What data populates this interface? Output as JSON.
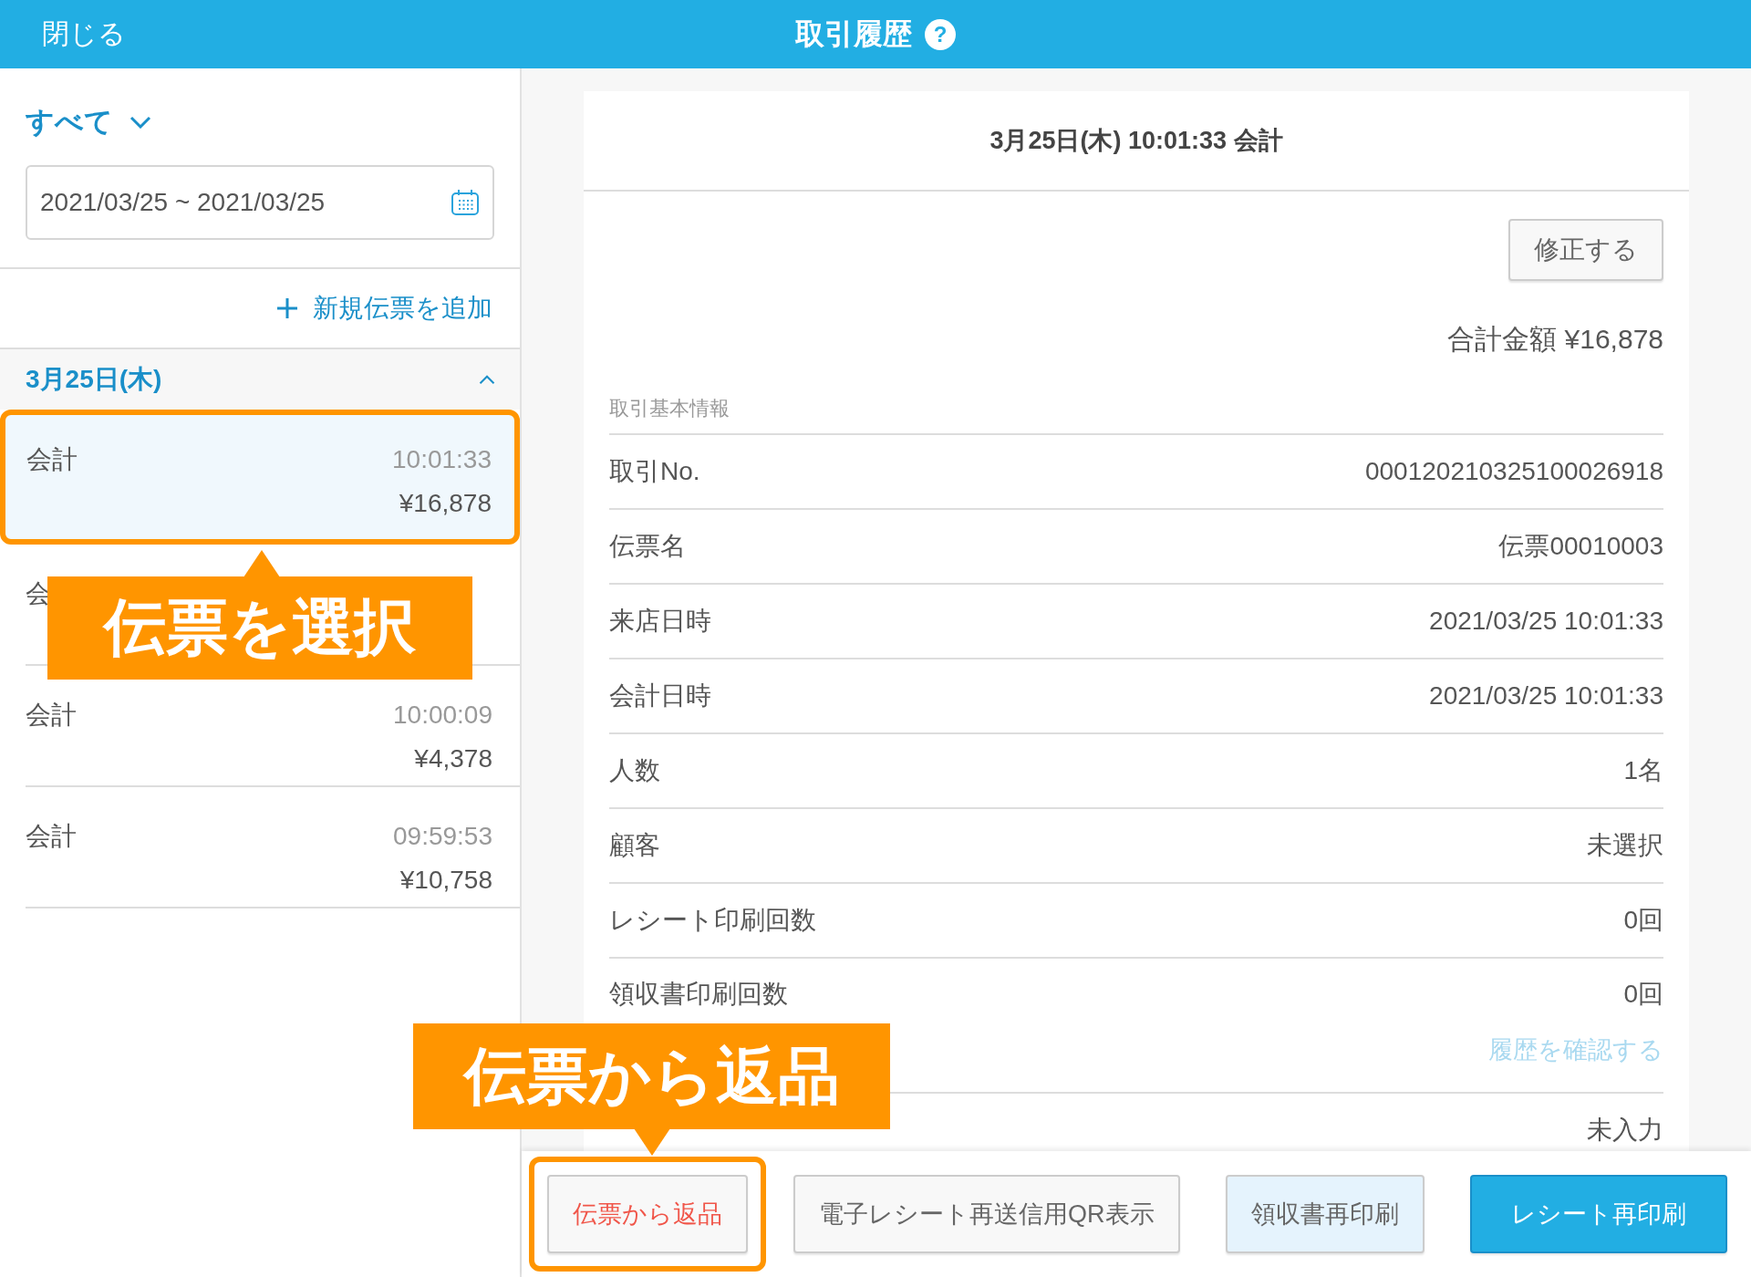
{
  "header": {
    "close": "閉じる",
    "title": "取引履歴",
    "help": "?"
  },
  "sidebar": {
    "filter": "すべて",
    "date_range": "2021/03/25 ~ 2021/03/25",
    "add_link": "新規伝票を追加",
    "groups": [
      {
        "date": "3月25日(木)",
        "expanded": true,
        "items": [
          {
            "label": "会計",
            "time": "10:01:33",
            "amount": "¥16,878",
            "selected": true
          },
          {
            "label": "会",
            "selected": false
          },
          {
            "label": "会計",
            "time": "10:00:09",
            "amount": "¥4,378",
            "selected": false
          },
          {
            "label": "会計",
            "time": "09:59:53",
            "amount": "¥10,758",
            "selected": false
          }
        ]
      }
    ]
  },
  "detail": {
    "title": "3月25日(木) 10:01:33 会計",
    "edit_button": "修正する",
    "total": "合計金額 ¥16,878",
    "section": "取引基本情報",
    "rows": [
      {
        "label": "取引No.",
        "value": "000120210325100026918"
      },
      {
        "label": "伝票名",
        "value": "伝票00010003"
      },
      {
        "label": "来店日時",
        "value": "2021/03/25 10:01:33"
      },
      {
        "label": "会計日時",
        "value": "2021/03/25 10:01:33"
      },
      {
        "label": "人数",
        "value": "1名"
      },
      {
        "label": "顧客",
        "value": "未選択"
      },
      {
        "label": "レシート印刷回数",
        "value": "0回"
      },
      {
        "label": "領収書印刷回数",
        "value": "0回",
        "link": "履歴を確認する"
      },
      {
        "value": "未入力"
      }
    ]
  },
  "actions": [
    {
      "label": "伝票から返品",
      "kind": "danger",
      "highlighted": true
    },
    {
      "label": "電子レシート再送信用QR表示",
      "kind": "default",
      "highlighted": false
    },
    {
      "label": "領収書再印刷",
      "kind": "light",
      "highlighted": false
    },
    {
      "label": "レシート再印刷",
      "kind": "primary",
      "highlighted": false
    }
  ],
  "callouts": [
    {
      "text": "伝票を選択"
    },
    {
      "text": "伝票から返品"
    }
  ]
}
